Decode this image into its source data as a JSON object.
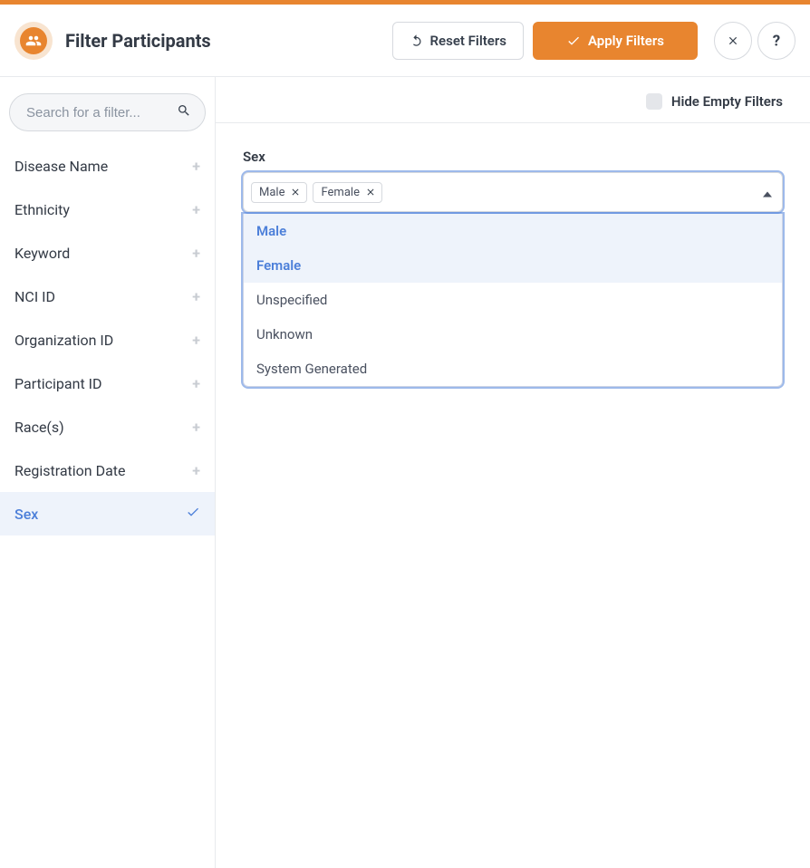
{
  "header": {
    "title": "Filter Participants",
    "reset_label": "Reset Filters",
    "apply_label": "Apply Filters"
  },
  "sidebar": {
    "search_placeholder": "Search for a filter...",
    "items": [
      {
        "label": "Disease Name",
        "active": false
      },
      {
        "label": "Ethnicity",
        "active": false
      },
      {
        "label": "Keyword",
        "active": false
      },
      {
        "label": "NCI ID",
        "active": false
      },
      {
        "label": "Organization ID",
        "active": false
      },
      {
        "label": "Participant ID",
        "active": false
      },
      {
        "label": "Race(s)",
        "active": false
      },
      {
        "label": "Registration Date",
        "active": false
      },
      {
        "label": "Sex",
        "active": true
      }
    ]
  },
  "main": {
    "hide_empty_label": "Hide Empty Filters",
    "hide_empty_checked": false,
    "field": {
      "label": "Sex",
      "chips": [
        "Male",
        "Female"
      ],
      "options": [
        {
          "label": "Male",
          "selected": true
        },
        {
          "label": "Female",
          "selected": true
        },
        {
          "label": "Unspecified",
          "selected": false
        },
        {
          "label": "Unknown",
          "selected": false
        },
        {
          "label": "System Generated",
          "selected": false
        }
      ]
    }
  }
}
